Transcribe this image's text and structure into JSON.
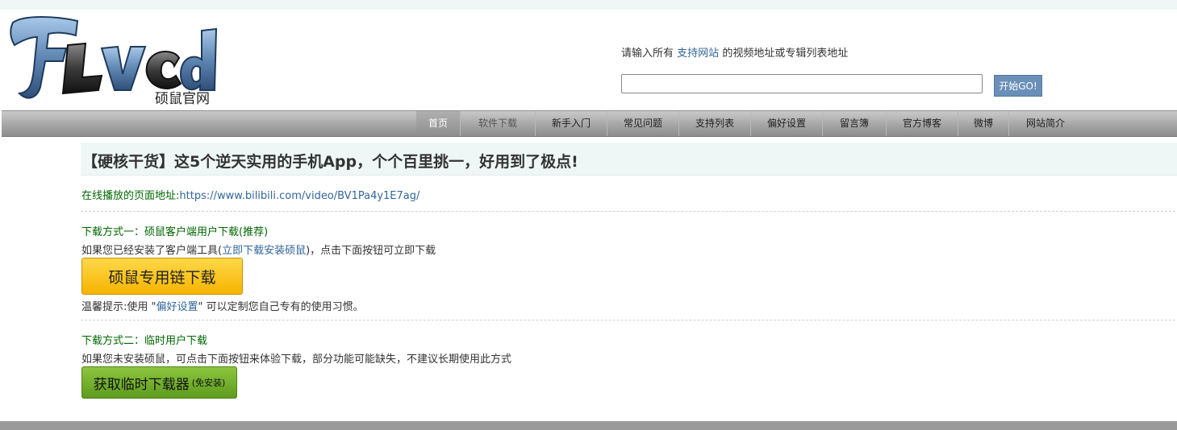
{
  "logo": {
    "text": "FLVCD",
    "subtitle": "硕鼠官网"
  },
  "search": {
    "hint_prefix": "请输入所有",
    "hint_link": "支持网站",
    "hint_suffix": "的视频地址或专辑列表地址",
    "value": "",
    "placeholder": "",
    "go_label": "开始GO!"
  },
  "nav": {
    "items": [
      {
        "label": "首页",
        "state": "active"
      },
      {
        "label": "软件下载",
        "state": "muted"
      },
      {
        "label": "新手入门",
        "state": "normal"
      },
      {
        "label": "常见问题",
        "state": "normal"
      },
      {
        "label": "支持列表",
        "state": "normal"
      },
      {
        "label": "偏好设置",
        "state": "normal"
      },
      {
        "label": "留言簿",
        "state": "normal"
      },
      {
        "label": "官方博客",
        "state": "normal"
      },
      {
        "label": "微博",
        "state": "normal"
      },
      {
        "label": "网站简介",
        "state": "normal"
      }
    ]
  },
  "content": {
    "title": "【硬核干货】这5个逆天实用的手机App，个个百里挑一，好用到了极点!",
    "page_url_label": "在线播放的页面地址:",
    "page_url": "https://www.bilibili.com/video/BV1Pa4y1E7ag/",
    "method1_title": "下载方式一：硕鼠客户端用户下载(推荐)",
    "method1_desc_prefix": "如果您已经安装了客户端工具(",
    "method1_desc_link": "立即下载安装硕鼠",
    "method1_desc_suffix": ")，点击下面按钮可立即下载",
    "method1_button": "硕鼠专用链下载",
    "tip_prefix": "温馨提示:使用 \"",
    "tip_link": "偏好设置",
    "tip_suffix": "\" 可以定制您自己专有的使用习惯。",
    "method2_title": "下载方式二：临时用户下载",
    "method2_desc": "如果您未安装硕鼠，可点击下面按钮来体验下载，部分功能可能缺失，不建议长期使用此方式",
    "method2_button": "获取临时下载器",
    "method2_button_note": "(免安装)"
  },
  "colors": {
    "nav_bg": "#a6a6a6",
    "title_bg": "#eef7f5",
    "green_text": "#006600",
    "link": "#336699",
    "go_button": "#6a8fb8",
    "yellow_button": "#f5b400",
    "green_button": "#5e9a1e"
  }
}
